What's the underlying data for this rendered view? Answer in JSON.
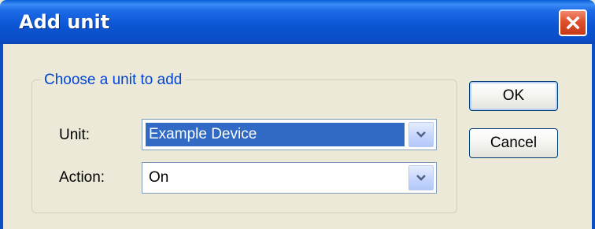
{
  "window": {
    "title": "Add unit",
    "close_icon": "close-icon",
    "colors": {
      "titlebar": "#0a54d2",
      "face": "#ece9d8",
      "close": "#e0502c",
      "legend": "#0046d5",
      "selection": "#316ac5"
    }
  },
  "group": {
    "legend": "Choose a unit to add"
  },
  "fields": {
    "unit": {
      "label": "Unit:",
      "value": "Example Device",
      "icon": "chevron-down-icon"
    },
    "action": {
      "label": "Action:",
      "value": "On",
      "icon": "chevron-down-icon"
    }
  },
  "buttons": {
    "ok": "OK",
    "cancel": "Cancel"
  }
}
